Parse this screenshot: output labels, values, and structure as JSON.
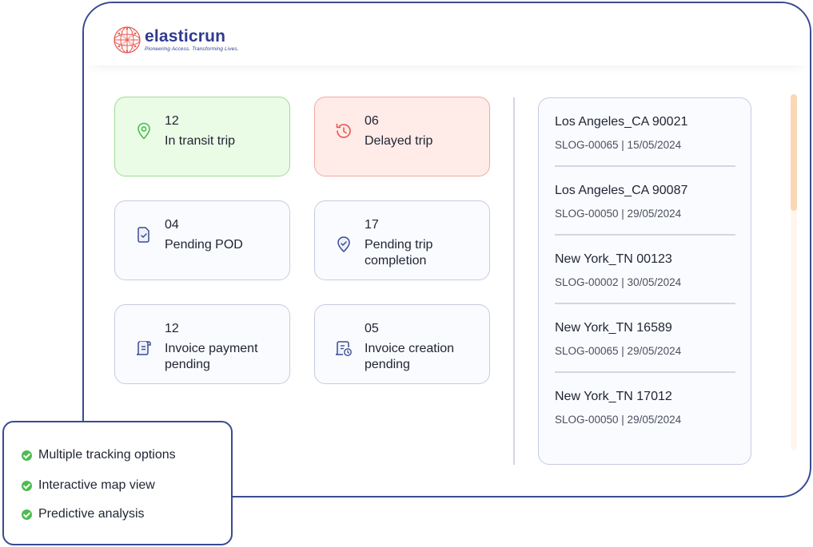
{
  "brand": {
    "name": "elasticrun",
    "tagline": "Pioneering Access. Transforming Lives.",
    "color": "#2f3b8f",
    "accent": "#e8564f"
  },
  "tiles": [
    {
      "count": "12",
      "label": "In transit trip",
      "icon": "location-pin-icon",
      "color": "#4cbc4f"
    },
    {
      "count": "06",
      "label": "Delayed trip",
      "icon": "clock-refresh-icon",
      "color": "#e8564f"
    },
    {
      "count": "04",
      "label": "Pending POD",
      "icon": "document-check-icon",
      "color": "#3a4a93"
    },
    {
      "count": "17",
      "label": "Pending trip completion",
      "icon": "shield-check-icon",
      "color": "#3a4a93"
    },
    {
      "count": "12",
      "label": "Invoice payment pending",
      "icon": "invoice-scroll-icon",
      "color": "#3a4a93"
    },
    {
      "count": "05",
      "label": "Invoice creation pending",
      "icon": "invoice-clock-icon",
      "color": "#3a4a93"
    }
  ],
  "trips": [
    {
      "place": "Los Angeles_CA 90021",
      "meta": "SLOG-00065  | 15/05/2024"
    },
    {
      "place": "Los Angeles_CA 90087",
      "meta": "SLOG-00050 | 29/05/2024"
    },
    {
      "place": "New York_TN 00123",
      "meta": "SLOG-00002  | 30/05/2024"
    },
    {
      "place": "New York_TN 16589",
      "meta": "SLOG-00065  | 29/05/2024"
    },
    {
      "place": "New York_TN 17012",
      "meta": "SLOG-00050 | 29/05/2024"
    }
  ],
  "features": [
    "Multiple tracking options",
    "Interactive map view",
    "Predictive analysis"
  ]
}
